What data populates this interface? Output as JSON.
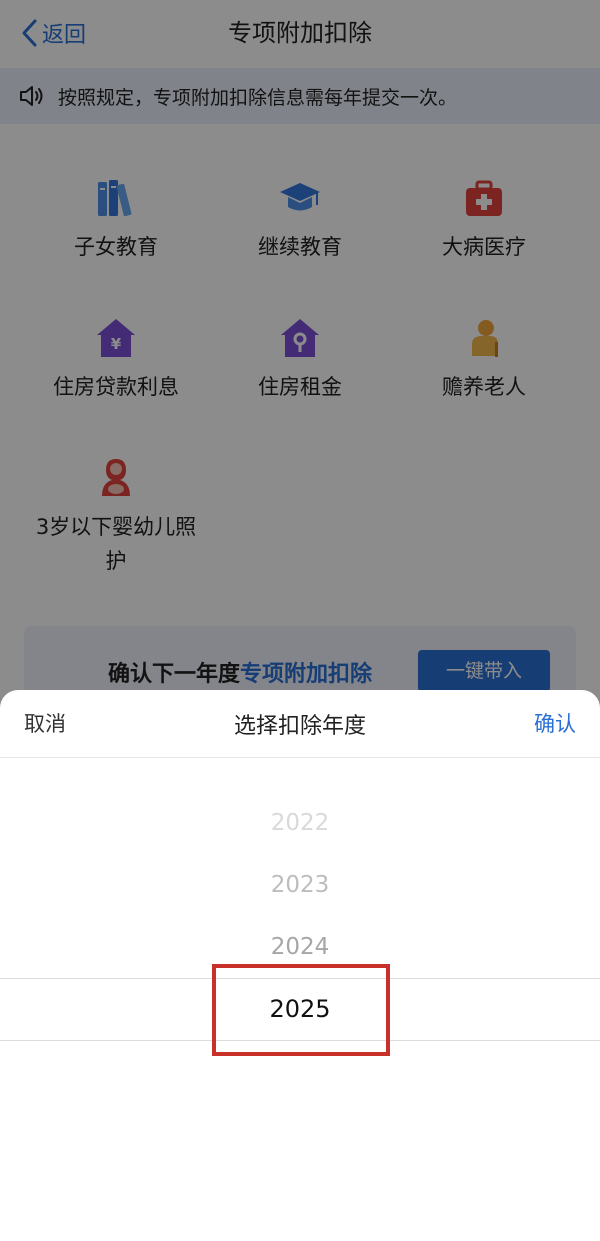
{
  "nav": {
    "back_label": "返回",
    "title": "专项附加扣除"
  },
  "notice": {
    "text": "按照规定，专项附加扣除信息需每年提交一次。"
  },
  "grid": [
    {
      "label": "子女教育",
      "icon": "books-icon"
    },
    {
      "label": "继续教育",
      "icon": "graduation-cap-icon"
    },
    {
      "label": "大病医疗",
      "icon": "medical-kit-icon"
    },
    {
      "label": "住房贷款利息",
      "icon": "house-loan-icon"
    },
    {
      "label": "住房租金",
      "icon": "house-rent-icon"
    },
    {
      "label": "赡养老人",
      "icon": "elderly-icon"
    },
    {
      "label": "3岁以下婴幼儿照",
      "label2": "护",
      "icon": "infant-care-icon"
    }
  ],
  "banner": {
    "text_prefix": "确认下一年度",
    "text_highlight": "专项附加扣除",
    "button_label": "一键带入"
  },
  "picker": {
    "cancel_label": "取消",
    "title": "选择扣除年度",
    "confirm_label": "确认",
    "years": [
      "2022",
      "2023",
      "2024",
      "2025"
    ],
    "selected": "2025"
  },
  "colors": {
    "accent": "#2a6fd6",
    "highlight_border": "#c8312a",
    "overlay": "rgba(0,0,0,0.45)"
  }
}
